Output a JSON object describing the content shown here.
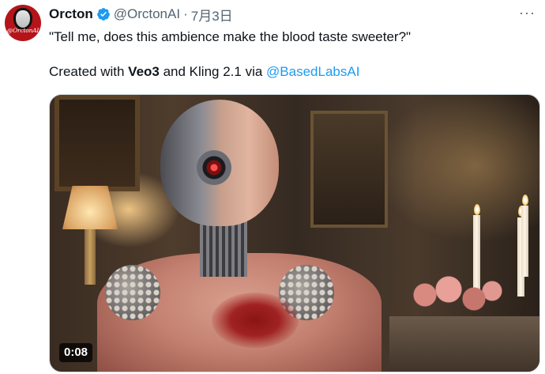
{
  "author": {
    "name": "Orcton",
    "handle": "@OrctonAI",
    "separator": "·",
    "date": "7月3日",
    "avatar_text": "@OrctonAI"
  },
  "menu": {
    "more_label": "···"
  },
  "tweet": {
    "line1": "\"Tell me, does this ambience make the blood taste sweeter?\"",
    "line2_prefix": "Created with ",
    "line2_bold": "Veo3",
    "line2_middle": " and Kling 2.1 via ",
    "line2_link": "@BasedLabsAI"
  },
  "media": {
    "duration": "0:08"
  },
  "icons": {
    "verified": "verified-badge-icon",
    "more": "more-dots-icon"
  },
  "colors": {
    "text": "#0f1419",
    "muted": "#536471",
    "link": "#1d9bf0",
    "verified": "#1d9bf0"
  }
}
